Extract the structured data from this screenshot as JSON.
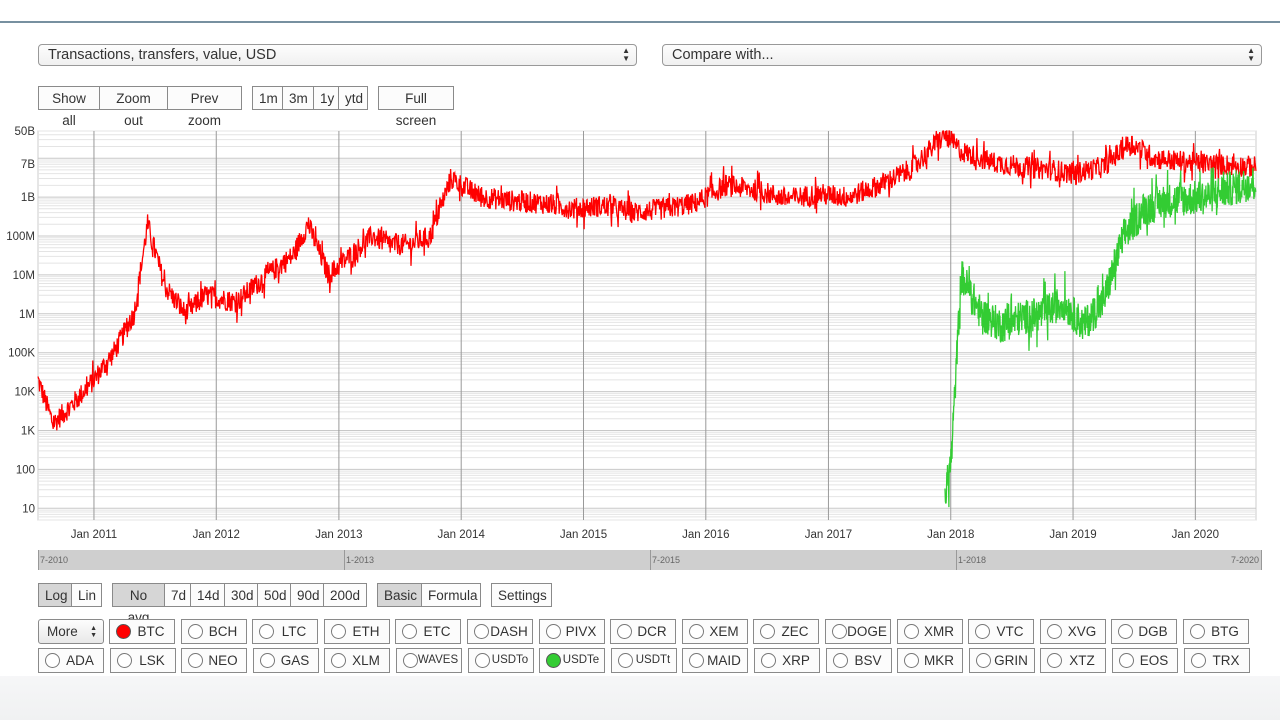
{
  "metric_select": {
    "value": "Transactions, transfers, value, USD"
  },
  "compare_select": {
    "value": "Compare with..."
  },
  "zoom_buttons": {
    "show_all": "Show all",
    "zoom_out": "Zoom out",
    "prev_zoom": "Prev zoom"
  },
  "range_buttons": {
    "m1": "1m",
    "m3": "3m",
    "y1": "1y",
    "ytd": "ytd"
  },
  "fullscreen": "Full screen",
  "scale_buttons": {
    "log": "Log",
    "lin": "Lin"
  },
  "avg_buttons": [
    "No avg",
    "7d",
    "14d",
    "30d",
    "50d",
    "90d",
    "200d"
  ],
  "mode_buttons": {
    "basic": "Basic",
    "formula": "Formula"
  },
  "settings": "Settings",
  "more": "More",
  "coins_row1": [
    "BTC",
    "BCH",
    "LTC",
    "ETH",
    "ETC",
    "DASH",
    "PIVX",
    "DCR",
    "XEM",
    "ZEC",
    "DOGE",
    "XMR",
    "VTC",
    "XVG",
    "DGB",
    "BTG"
  ],
  "coins_row2": [
    "ADA",
    "LSK",
    "NEO",
    "GAS",
    "XLM",
    "WAVES",
    "USDTo",
    "USDTe",
    "USDTt",
    "MAID",
    "XRP",
    "BSV",
    "MKR",
    "GRIN",
    "XTZ",
    "EOS",
    "TRX"
  ],
  "navigator": {
    "labels": [
      "7-2010",
      "1-2013",
      "7-2015",
      "1-2018",
      "7-2020"
    ]
  },
  "colors": {
    "btc": "#ff0000",
    "usdte": "#33cc33",
    "grid": "#dddddd"
  },
  "chart_data": {
    "type": "line",
    "scale": "log",
    "ylim": [
      5,
      50000000000
    ],
    "y_ticks": [
      "10",
      "100",
      "1K",
      "10K",
      "100K",
      "1M",
      "10M",
      "100M",
      "1B",
      "7B",
      "50B"
    ],
    "x_ticks": [
      "Jan 2011",
      "Jan 2012",
      "Jan 2013",
      "Jan 2014",
      "Jan 2015",
      "Jan 2016",
      "Jan 2017",
      "Jan 2018",
      "Jan 2019",
      "Jan 2020"
    ],
    "xlim": [
      "2010-07-18",
      "2020-06-30"
    ],
    "grid": true,
    "series": [
      {
        "name": "BTC",
        "color": "#ff0000",
        "x": [
          "2010-07-18",
          "2010-09-01",
          "2010-11-01",
          "2011-01-01",
          "2011-03-01",
          "2011-05-01",
          "2011-06-10",
          "2011-08-01",
          "2011-10-01",
          "2011-12-01",
          "2012-03-01",
          "2012-06-01",
          "2012-08-15",
          "2012-10-01",
          "2012-12-01",
          "2013-02-01",
          "2013-04-10",
          "2013-06-01",
          "2013-08-01",
          "2013-10-01",
          "2013-12-01",
          "2014-03-01",
          "2014-06-01",
          "2014-09-01",
          "2014-12-01",
          "2015-03-01",
          "2015-06-01",
          "2015-09-01",
          "2015-12-01",
          "2016-03-01",
          "2016-06-01",
          "2016-09-01",
          "2016-12-01",
          "2017-03-01",
          "2017-06-01",
          "2017-09-01",
          "2017-12-15",
          "2018-02-01",
          "2018-05-01",
          "2018-08-01",
          "2018-11-01",
          "2019-01-01",
          "2019-04-01",
          "2019-06-20",
          "2019-09-01",
          "2019-12-01",
          "2020-03-01",
          "2020-06-30"
        ],
        "y": [
          20000,
          1500,
          5000,
          20000,
          100000,
          1000000,
          200000000,
          5000000,
          1000000,
          3000000,
          2000000,
          10000000,
          30000000,
          200000000,
          10000000,
          30000000,
          100000000,
          60000000,
          60000000,
          100000000,
          3000000000,
          1000000000,
          800000000,
          700000000,
          500000000,
          600000000,
          400000000,
          500000000,
          700000000,
          2000000000,
          1500000000,
          900000000,
          1200000000,
          1000000000,
          2000000000,
          5000000000,
          40000000000,
          15000000000,
          8000000000,
          6000000000,
          5000000000,
          4000000000,
          6000000000,
          25000000000,
          10000000000,
          8000000000,
          7000000000,
          6000000000
        ]
      },
      {
        "name": "USDTe",
        "color": "#33cc33",
        "x": [
          "2017-12-15",
          "2018-01-03",
          "2018-02-01",
          "2018-04-01",
          "2018-06-01",
          "2018-08-01",
          "2018-10-01",
          "2018-12-01",
          "2019-02-01",
          "2019-04-01",
          "2019-06-01",
          "2019-08-01",
          "2019-10-01",
          "2019-12-01",
          "2020-02-01",
          "2020-04-01",
          "2020-06-30"
        ],
        "y": [
          20,
          200,
          10000000,
          1000000,
          500000,
          800000,
          1000000,
          2000000,
          500000,
          2000000,
          100000000,
          500000000,
          800000000,
          900000000,
          1000000000,
          1500000000,
          2500000000
        ]
      }
    ]
  }
}
